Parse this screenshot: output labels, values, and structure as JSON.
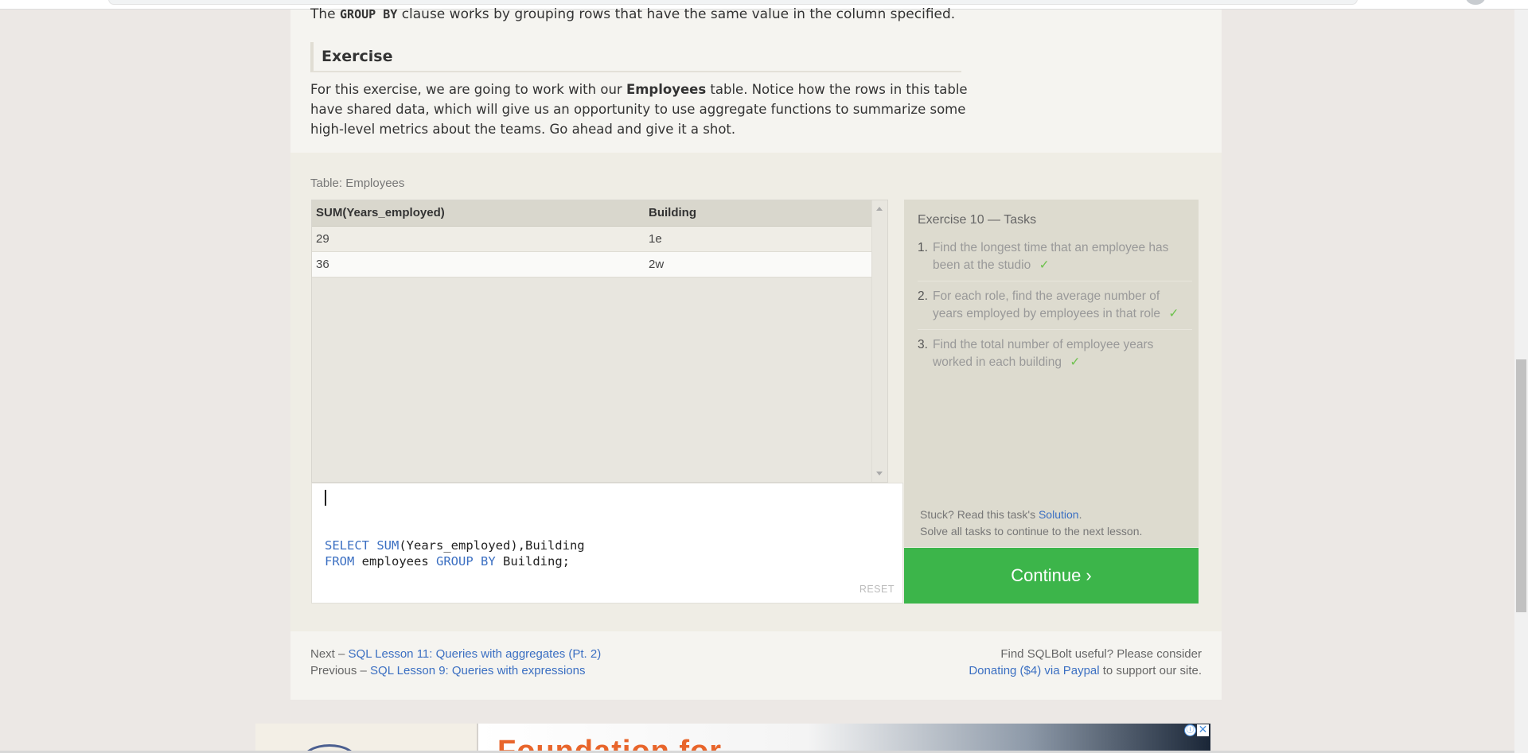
{
  "lesson": {
    "intro_prefix": "The",
    "intro_keyword": "GROUP BY",
    "intro_suffix": "clause works by grouping rows that have the same value in the column specified.",
    "exercise_heading": "Exercise",
    "desc_part1": "For this exercise, we are going to work with our",
    "desc_bold": "Employees",
    "desc_part2": "table. Notice how the rows in this table have shared data, which will give us an opportunity to use aggregate functions to summarize some high-level metrics about the teams. Go ahead and give it a shot."
  },
  "result_table": {
    "caption": "Table: Employees",
    "columns": [
      "SUM(Years_employed)",
      "Building"
    ],
    "rows": [
      [
        "29",
        "1e"
      ],
      [
        "36",
        "2w"
      ]
    ]
  },
  "editor": {
    "line1_kw1": "SELECT",
    "line1_fn": "SUM",
    "line1_rest": "(Years_employed),Building",
    "line2_kw1": "FROM",
    "line2_mid": "employees",
    "line2_kw2": "GROUP BY",
    "line2_rest": "Building;",
    "reset_label": "RESET"
  },
  "tasks": {
    "title": "Exercise 10 — Tasks",
    "items": [
      {
        "num": "1.",
        "text": "Find the longest time that an employee has been at the studio",
        "check": "✓"
      },
      {
        "num": "2.",
        "text": "For each role, find the average number of years employed by employees in that role",
        "check": "✓"
      },
      {
        "num": "3.",
        "text": "Find the total number of employee years worked in each building",
        "check": "✓"
      }
    ],
    "stuck_prefix": "Stuck? Read this task's",
    "solution_link": "Solution",
    "stuck_suffix": ".",
    "solve_all": "Solve all tasks to continue to the next lesson.",
    "continue_label": "Continue ›"
  },
  "nav": {
    "next_prefix": "Next –",
    "next_link": "SQL Lesson 11: Queries with aggregates (Pt. 2)",
    "prev_prefix": "Previous –",
    "prev_link": "SQL Lesson 9: Queries with expressions",
    "support_line1": "Find SQLBolt useful? Please consider",
    "donate_link": "Donating ($4) via Paypal",
    "support_suffix": "to support our site."
  },
  "ad": {
    "banner_text": "Foundation for",
    "info_glyph": "ⓘ",
    "close_glyph": "✕"
  },
  "colors": {
    "continue_green": "#3cb54a",
    "link_blue": "#3b6fc2",
    "check_green": "#6fc24f"
  }
}
